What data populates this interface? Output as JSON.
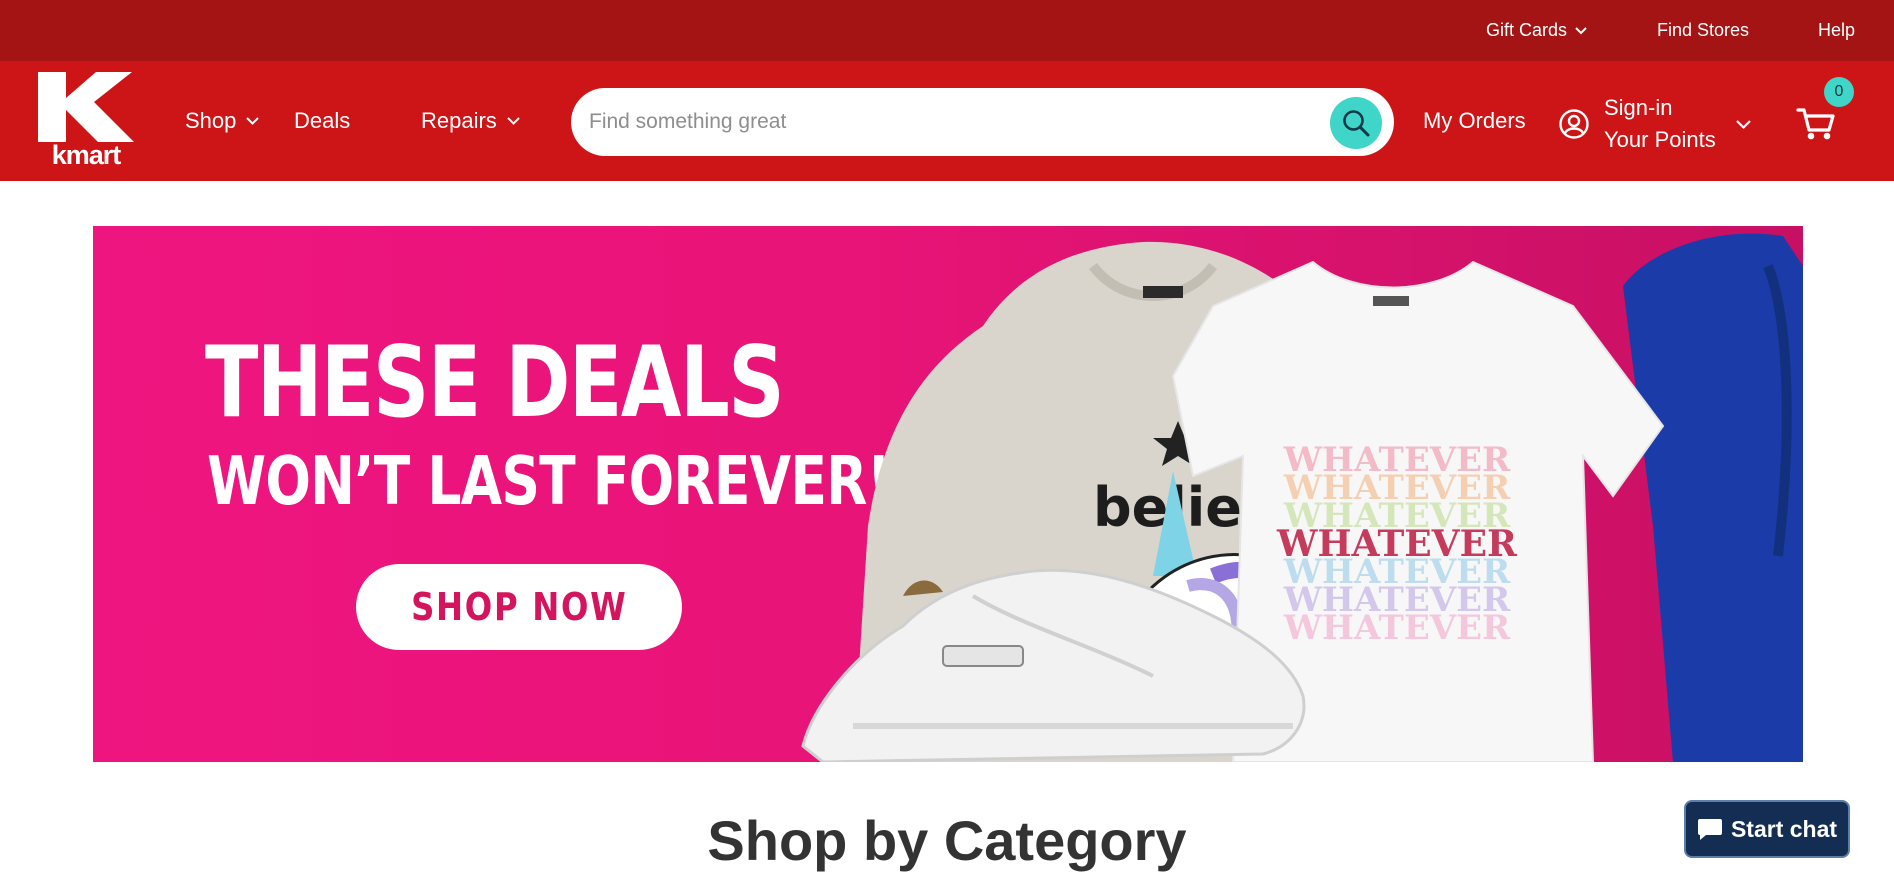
{
  "topbar": {
    "gift_cards": "Gift Cards",
    "find_stores": "Find Stores",
    "help": "Help"
  },
  "brand": {
    "logo_text": "kmart",
    "colors": {
      "topbar": "#a51414",
      "navbar": "#cd1517",
      "accent": "#3fd6c9",
      "hero": "#ef1580"
    }
  },
  "nav": {
    "shop": "Shop",
    "deals": "Deals",
    "repairs": "Repairs"
  },
  "search": {
    "placeholder": "Find something great",
    "icon": "search-icon"
  },
  "account": {
    "my_orders": "My Orders",
    "sign_in": "Sign-in",
    "points": "Your Points",
    "icon": "user-circle-icon"
  },
  "cart": {
    "count": "0",
    "icon": "cart-icon"
  },
  "hero": {
    "line1": "THESE DEALS",
    "line2": "WON’T LAST FOREVER!",
    "cta": "SHOP NOW",
    "sweatshirt_text": "believe",
    "tee_text": "WHATEVER"
  },
  "section": {
    "title": "Shop by Category"
  },
  "chat": {
    "label": "Start chat",
    "icon": "chat-bubble-icon"
  }
}
